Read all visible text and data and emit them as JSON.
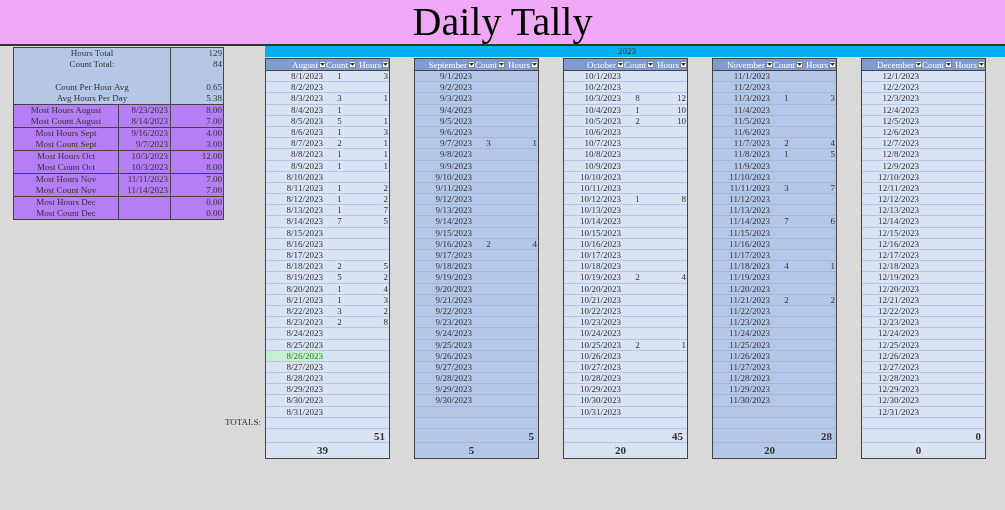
{
  "title": "Daily Tally",
  "summary": [
    {
      "label": "Hours Total",
      "value": "129"
    },
    {
      "label": "Count Total:",
      "value": "84"
    },
    {
      "label": "Count Per Hour Avg",
      "value": "0.65"
    },
    {
      "label": "Avg Hours Per Day",
      "value": "5.38"
    }
  ],
  "records": [
    [
      {
        "label": "Most Hours August",
        "date": "8/23/2023",
        "value": "8.00"
      },
      {
        "label": "Most Count August",
        "date": "8/14/2023",
        "value": "7.00"
      }
    ],
    [
      {
        "label": "Most Hours Sept",
        "date": "9/16/2023",
        "value": "4.00"
      },
      {
        "label": "Most Count Sept",
        "date": "9/7/2023",
        "value": "3.00"
      }
    ],
    [
      {
        "label": "Most Hours Oct",
        "date": "10/3/2023",
        "value": "12.00"
      },
      {
        "label": "Most Count Oct",
        "date": "10/3/2023",
        "value": "8.00"
      }
    ],
    [
      {
        "label": "Most Hours Nov",
        "date": "11/11/2023",
        "value": "7.00"
      },
      {
        "label": "Most Count Nov",
        "date": "11/14/2023",
        "value": "7.00"
      }
    ],
    [
      {
        "label": "Most Hours Dec",
        "value": "0.00"
      },
      {
        "label": "Most Count Dec",
        "value": "0.00"
      }
    ]
  ],
  "year": "2023",
  "totals_label": "TOTALS:",
  "months": [
    {
      "name": "August",
      "kind": "light",
      "columns": [
        "Count",
        "Hours"
      ],
      "hours_total": "51",
      "count_total": "39",
      "rows": [
        {
          "date": "8/1/2023",
          "count": "1",
          "hours": "3",
          "highlighted": false
        },
        {
          "date": "8/2/2023",
          "highlighted": false
        },
        {
          "date": "8/3/2023",
          "count": "3",
          "hours": "1",
          "highlighted": false
        },
        {
          "date": "8/4/2023",
          "count": "1",
          "highlighted": false
        },
        {
          "date": "8/5/2023",
          "count": "5",
          "hours": "1",
          "highlighted": false
        },
        {
          "date": "8/6/2023",
          "count": "1",
          "hours": "3",
          "highlighted": false
        },
        {
          "date": "8/7/2023",
          "count": "2",
          "hours": "1",
          "highlighted": false
        },
        {
          "date": "8/8/2023",
          "count": "1",
          "hours": "1",
          "highlighted": false
        },
        {
          "date": "8/9/2023",
          "count": "1",
          "hours": "1",
          "highlighted": false
        },
        {
          "date": "8/10/2023",
          "highlighted": false
        },
        {
          "date": "8/11/2023",
          "count": "1",
          "hours": "2",
          "highlighted": false
        },
        {
          "date": "8/12/2023",
          "count": "1",
          "hours": "2",
          "highlighted": false
        },
        {
          "date": "8/13/2023",
          "count": "1",
          "hours": "7",
          "highlighted": false
        },
        {
          "date": "8/14/2023",
          "count": "7",
          "hours": "5",
          "highlighted": false
        },
        {
          "date": "8/15/2023",
          "highlighted": false
        },
        {
          "date": "8/16/2023",
          "highlighted": false
        },
        {
          "date": "8/17/2023",
          "highlighted": false
        },
        {
          "date": "8/18/2023",
          "count": "2",
          "hours": "5",
          "highlighted": false
        },
        {
          "date": "8/19/2023",
          "count": "5",
          "hours": "2",
          "highlighted": false
        },
        {
          "date": "8/20/2023",
          "count": "1",
          "hours": "4",
          "highlighted": false
        },
        {
          "date": "8/21/2023",
          "count": "1",
          "hours": "3",
          "highlighted": false
        },
        {
          "date": "8/22/2023",
          "count": "3",
          "hours": "2",
          "highlighted": false
        },
        {
          "date": "8/23/2023",
          "count": "2",
          "hours": "8",
          "highlighted": false
        },
        {
          "date": "8/24/2023",
          "highlighted": false
        },
        {
          "date": "8/25/2023",
          "highlighted": false
        },
        {
          "date": "8/26/2023",
          "highlighted": true
        },
        {
          "date": "8/27/2023",
          "highlighted": false
        },
        {
          "date": "8/28/2023",
          "highlighted": false
        },
        {
          "date": "8/29/2023",
          "highlighted": false
        },
        {
          "date": "8/30/2023",
          "highlighted": false
        },
        {
          "date": "8/31/2023",
          "highlighted": false
        }
      ]
    },
    {
      "name": "September",
      "kind": "dark",
      "columns": [
        "Count",
        "Hours"
      ],
      "hours_total": "5",
      "count_total": "5",
      "rows": [
        {
          "date": "9/1/2023",
          "highlighted": false
        },
        {
          "date": "9/2/2023",
          "highlighted": false
        },
        {
          "date": "9/3/2023",
          "highlighted": false
        },
        {
          "date": "9/4/2023",
          "highlighted": false
        },
        {
          "date": "9/5/2023",
          "highlighted": false
        },
        {
          "date": "9/6/2023",
          "highlighted": false
        },
        {
          "date": "9/7/2023",
          "count": "3",
          "hours": "1",
          "highlighted": false
        },
        {
          "date": "9/8/2023",
          "highlighted": false
        },
        {
          "date": "9/9/2023",
          "highlighted": false
        },
        {
          "date": "9/10/2023",
          "highlighted": false
        },
        {
          "date": "9/11/2023",
          "highlighted": false
        },
        {
          "date": "9/12/2023",
          "highlighted": false
        },
        {
          "date": "9/13/2023",
          "highlighted": false
        },
        {
          "date": "9/14/2023",
          "highlighted": false
        },
        {
          "date": "9/15/2023",
          "highlighted": false
        },
        {
          "date": "9/16/2023",
          "count": "2",
          "hours": "4",
          "highlighted": false
        },
        {
          "date": "9/17/2023",
          "highlighted": false
        },
        {
          "date": "9/18/2023",
          "highlighted": false
        },
        {
          "date": "9/19/2023",
          "highlighted": false
        },
        {
          "date": "9/20/2023",
          "highlighted": false
        },
        {
          "date": "9/21/2023",
          "highlighted": false
        },
        {
          "date": "9/22/2023",
          "highlighted": false
        },
        {
          "date": "9/23/2023",
          "highlighted": false
        },
        {
          "date": "9/24/2023",
          "highlighted": false
        },
        {
          "date": "9/25/2023",
          "highlighted": false
        },
        {
          "date": "9/26/2023",
          "highlighted": false
        },
        {
          "date": "9/27/2023",
          "highlighted": false
        },
        {
          "date": "9/28/2023",
          "highlighted": false
        },
        {
          "date": "9/29/2023",
          "highlighted": false
        },
        {
          "date": "9/30/2023",
          "highlighted": false
        }
      ]
    },
    {
      "name": "October",
      "kind": "light",
      "columns": [
        "Count",
        "Hours"
      ],
      "hours_total": "45",
      "count_total": "20",
      "rows": [
        {
          "date": "10/1/2023",
          "highlighted": false
        },
        {
          "date": "10/2/2023",
          "highlighted": false
        },
        {
          "date": "10/3/2023",
          "count": "8",
          "hours": "12",
          "highlighted": false
        },
        {
          "date": "10/4/2023",
          "count": "1",
          "hours": "10",
          "highlighted": false
        },
        {
          "date": "10/5/2023",
          "count": "2",
          "hours": "10",
          "highlighted": false
        },
        {
          "date": "10/6/2023",
          "highlighted": false
        },
        {
          "date": "10/7/2023",
          "highlighted": false
        },
        {
          "date": "10/8/2023",
          "highlighted": false
        },
        {
          "date": "10/9/2023",
          "highlighted": false
        },
        {
          "date": "10/10/2023",
          "highlighted": false
        },
        {
          "date": "10/11/2023",
          "highlighted": false
        },
        {
          "date": "10/12/2023",
          "count": "1",
          "hours": "8",
          "highlighted": false
        },
        {
          "date": "10/13/2023",
          "highlighted": false
        },
        {
          "date": "10/14/2023",
          "highlighted": false
        },
        {
          "date": "10/15/2023",
          "highlighted": false
        },
        {
          "date": "10/16/2023",
          "highlighted": false
        },
        {
          "date": "10/17/2023",
          "highlighted": false
        },
        {
          "date": "10/18/2023",
          "highlighted": false
        },
        {
          "date": "10/19/2023",
          "count": "2",
          "hours": "4",
          "highlighted": false
        },
        {
          "date": "10/20/2023",
          "highlighted": false
        },
        {
          "date": "10/21/2023",
          "highlighted": false
        },
        {
          "date": "10/22/2023",
          "highlighted": false
        },
        {
          "date": "10/23/2023",
          "highlighted": false
        },
        {
          "date": "10/24/2023",
          "highlighted": false
        },
        {
          "date": "10/25/2023",
          "count": "2",
          "hours": "1",
          "highlighted": false
        },
        {
          "date": "10/26/2023",
          "highlighted": false
        },
        {
          "date": "10/27/2023",
          "highlighted": false
        },
        {
          "date": "10/28/2023",
          "highlighted": false
        },
        {
          "date": "10/29/2023",
          "highlighted": false
        },
        {
          "date": "10/30/2023",
          "highlighted": false
        },
        {
          "date": "10/31/2023",
          "highlighted": false
        }
      ]
    },
    {
      "name": "November",
      "kind": "dark",
      "columns": [
        "Count",
        "Hours"
      ],
      "hours_total": "28",
      "count_total": "20",
      "rows": [
        {
          "date": "11/1/2023",
          "highlighted": false
        },
        {
          "date": "11/2/2023",
          "highlighted": false
        },
        {
          "date": "11/3/2023",
          "count": "1",
          "hours": "3",
          "highlighted": false
        },
        {
          "date": "11/4/2023",
          "highlighted": false
        },
        {
          "date": "11/5/2023",
          "highlighted": false
        },
        {
          "date": "11/6/2023",
          "highlighted": false
        },
        {
          "date": "11/7/2023",
          "count": "2",
          "hours": "4",
          "highlighted": false
        },
        {
          "date": "11/8/2023",
          "count": "1",
          "hours": "5",
          "highlighted": false
        },
        {
          "date": "11/9/2023",
          "highlighted": false
        },
        {
          "date": "11/10/2023",
          "highlighted": false
        },
        {
          "date": "11/11/2023",
          "count": "3",
          "hours": "7",
          "highlighted": false
        },
        {
          "date": "11/12/2023",
          "highlighted": false
        },
        {
          "date": "11/13/2023",
          "highlighted": false
        },
        {
          "date": "11/14/2023",
          "count": "7",
          "hours": "6",
          "highlighted": false
        },
        {
          "date": "11/15/2023",
          "highlighted": false
        },
        {
          "date": "11/16/2023",
          "highlighted": false
        },
        {
          "date": "11/17/2023",
          "highlighted": false
        },
        {
          "date": "11/18/2023",
          "count": "4",
          "hours": "1",
          "highlighted": false
        },
        {
          "date": "11/19/2023",
          "highlighted": false
        },
        {
          "date": "11/20/2023",
          "highlighted": false
        },
        {
          "date": "11/21/2023",
          "count": "2",
          "hours": "2",
          "highlighted": false
        },
        {
          "date": "11/22/2023",
          "highlighted": false
        },
        {
          "date": "11/23/2023",
          "highlighted": false
        },
        {
          "date": "11/24/2023",
          "highlighted": false
        },
        {
          "date": "11/25/2023",
          "highlighted": false
        },
        {
          "date": "11/26/2023",
          "highlighted": false
        },
        {
          "date": "11/27/2023",
          "highlighted": false
        },
        {
          "date": "11/28/2023",
          "highlighted": false
        },
        {
          "date": "11/29/2023",
          "highlighted": false
        },
        {
          "date": "11/30/2023",
          "highlighted": false
        }
      ]
    },
    {
      "name": "December",
      "kind": "light",
      "columns": [
        "Count",
        "Hours"
      ],
      "hours_total": "0",
      "count_total": "0",
      "rows": [
        {
          "date": "12/1/2023",
          "highlighted": false
        },
        {
          "date": "12/2/2023",
          "highlighted": false
        },
        {
          "date": "12/3/2023",
          "highlighted": false
        },
        {
          "date": "12/4/2023",
          "highlighted": false
        },
        {
          "date": "12/5/2023",
          "highlighted": false
        },
        {
          "date": "12/6/2023",
          "highlighted": false
        },
        {
          "date": "12/7/2023",
          "highlighted": false
        },
        {
          "date": "12/8/2023",
          "highlighted": false
        },
        {
          "date": "12/9/2023",
          "highlighted": false
        },
        {
          "date": "12/10/2023",
          "highlighted": false
        },
        {
          "date": "12/11/2023",
          "highlighted": false
        },
        {
          "date": "12/12/2023",
          "highlighted": false
        },
        {
          "date": "12/13/2023",
          "highlighted": false
        },
        {
          "date": "12/14/2023",
          "highlighted": false
        },
        {
          "date": "12/15/2023",
          "highlighted": false
        },
        {
          "date": "12/16/2023",
          "highlighted": false
        },
        {
          "date": "12/17/2023",
          "highlighted": false
        },
        {
          "date": "12/18/2023",
          "highlighted": false
        },
        {
          "date": "12/19/2023",
          "highlighted": false
        },
        {
          "date": "12/20/2023",
          "highlighted": false
        },
        {
          "date": "12/21/2023",
          "highlighted": false
        },
        {
          "date": "12/22/2023",
          "highlighted": false
        },
        {
          "date": "12/23/2023",
          "highlighted": false
        },
        {
          "date": "12/24/2023",
          "highlighted": false
        },
        {
          "date": "12/25/2023",
          "highlighted": false
        },
        {
          "date": "12/26/2023",
          "highlighted": false
        },
        {
          "date": "12/27/2023",
          "highlighted": false
        },
        {
          "date": "12/28/2023",
          "highlighted": false
        },
        {
          "date": "12/29/2023",
          "highlighted": false
        },
        {
          "date": "12/30/2023",
          "highlighted": false
        },
        {
          "date": "12/31/2023",
          "highlighted": false
        }
      ]
    }
  ]
}
